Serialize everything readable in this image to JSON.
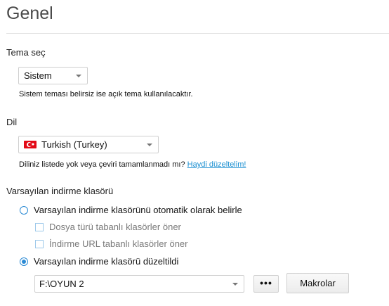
{
  "page": {
    "title": "Genel"
  },
  "theme": {
    "label": "Tema seç",
    "selected": "Sistem",
    "hint": "Sistem teması belirsiz ise açık tema kullanılacaktır."
  },
  "language": {
    "label": "Dil",
    "selected": "Turkish (Turkey)",
    "flag_icon": "turkey-flag-icon",
    "hint": "Diliniz listede yok veya çeviri tamamlanmadı mı?",
    "hint_link": "Haydi düzeltelim!",
    "link_color": "#1a8fd1"
  },
  "download": {
    "label": "Varsayılan indirme klasörü",
    "options": {
      "auto_label": "Varsayılan indirme klasörünü otomatik olarak belirle",
      "by_type_label": "Dosya türü tabanlı klasörler öner",
      "by_url_label": "İndirme URL tabanlı klasörler öner",
      "fixed_label": "Varsayılan indirme klasörü düzeltildi"
    },
    "selected_option": "fixed",
    "folder_value": "F:\\OYUN 2",
    "browse_label": "•••",
    "macros_label": "Makrolar",
    "accent_color": "#2a8ad4"
  }
}
